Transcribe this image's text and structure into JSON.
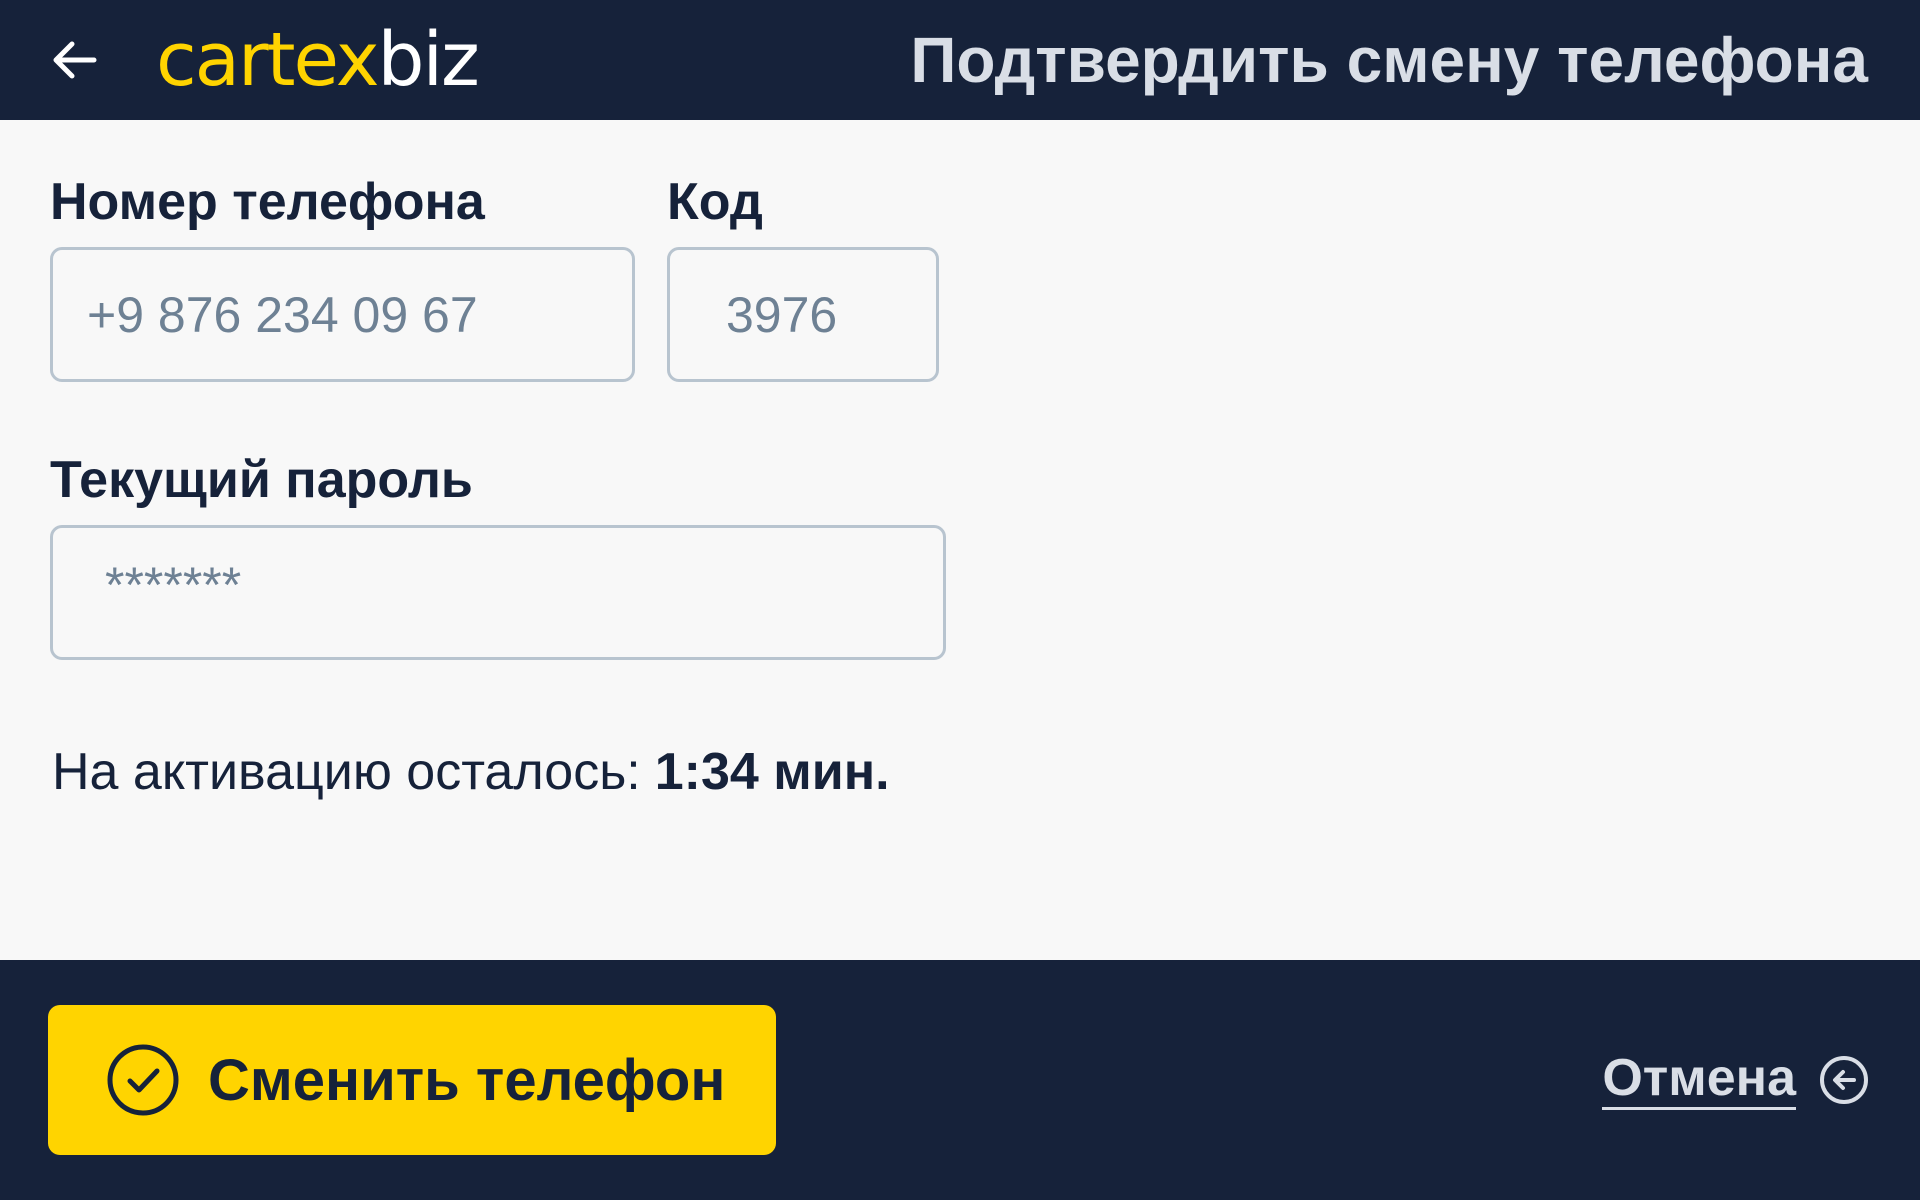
{
  "header": {
    "logo_part1": "cartex",
    "logo_part2": "biz",
    "title": "Подтвердить смену телефона"
  },
  "form": {
    "phone_label": "Номер телефона",
    "phone_placeholder": "+9 876 234 09 67",
    "code_label": "Код",
    "code_placeholder": "3976",
    "password_label": "Текущий пароль",
    "password_placeholder": "*******"
  },
  "timer": {
    "label": "На активацию осталось:",
    "value": "1:34 мин."
  },
  "footer": {
    "submit_label": "Сменить телефон",
    "cancel_label": "Отмена"
  },
  "colors": {
    "navy": "#16223a",
    "accent_yellow": "#ffd400",
    "background": "#f8f8f8"
  },
  "icons": {
    "back": "arrow-left-icon",
    "submit": "check-circle-icon",
    "cancel": "undo-circle-icon"
  }
}
